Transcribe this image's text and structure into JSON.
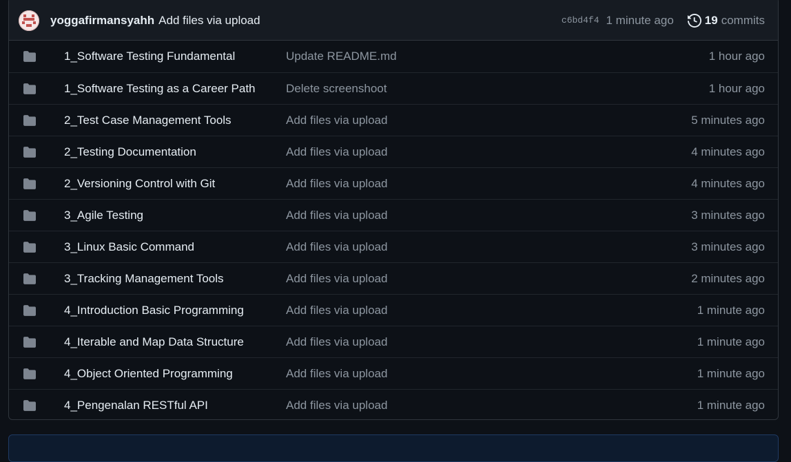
{
  "commit": {
    "author": "yoggafirmansyahh",
    "message": "Add files via upload",
    "sha": "c6bd4f4",
    "time": "1 minute ago",
    "commit_count": "19",
    "commits_label": "commits"
  },
  "icons": {
    "folder": "folder-icon",
    "history": "history-icon",
    "avatar": "avatar"
  },
  "colors": {
    "background": "#0d1117",
    "header": "#161b22",
    "border": "#30363d",
    "folder": "#7d8590",
    "muted": "#8d96a0"
  },
  "files": [
    {
      "name": "1_Software Testing Fundamental",
      "message": "Update README.md",
      "age": "1 hour ago"
    },
    {
      "name": "1_Software Testing as a Career Path",
      "message": "Delete screenshoot",
      "age": "1 hour ago"
    },
    {
      "name": "2_Test Case Management Tools",
      "message": "Add files via upload",
      "age": "5 minutes ago"
    },
    {
      "name": "2_Testing Documentation",
      "message": "Add files via upload",
      "age": "4 minutes ago"
    },
    {
      "name": "2_Versioning Control with Git",
      "message": "Add files via upload",
      "age": "4 minutes ago"
    },
    {
      "name": "3_Agile Testing",
      "message": "Add files via upload",
      "age": "3 minutes ago"
    },
    {
      "name": "3_Linux Basic Command",
      "message": "Add files via upload",
      "age": "3 minutes ago"
    },
    {
      "name": "3_Tracking Management Tools",
      "message": "Add files via upload",
      "age": "2 minutes ago"
    },
    {
      "name": "4_Introduction Basic Programming",
      "message": "Add files via upload",
      "age": "1 minute ago"
    },
    {
      "name": "4_Iterable and Map Data Structure",
      "message": "Add files via upload",
      "age": "1 minute ago"
    },
    {
      "name": "4_Object Oriented Programming",
      "message": "Add files via upload",
      "age": "1 minute ago"
    },
    {
      "name": "4_Pengenalan RESTful API",
      "message": "Add files via upload",
      "age": "1 minute ago"
    }
  ]
}
